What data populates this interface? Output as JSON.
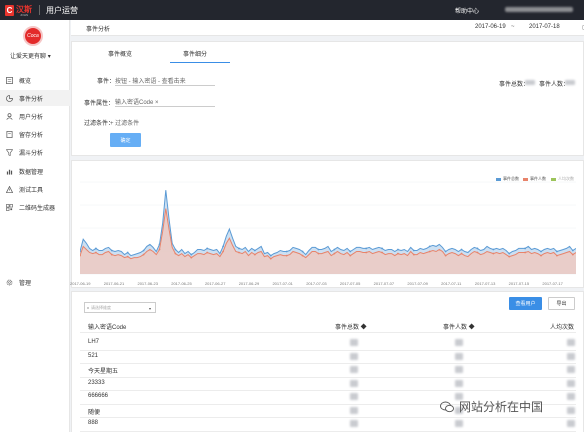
{
  "header": {
    "logo_text": "汉斯",
    "logo_sub": "JOHN",
    "app_title": "用户运营",
    "help": "帮助中心"
  },
  "sidebar": {
    "app_name": "让爱天更有聊",
    "items": [
      {
        "label": "概览",
        "icon": "overview-icon"
      },
      {
        "label": "事件分析",
        "icon": "event-analysis-icon"
      },
      {
        "label": "用户分析",
        "icon": "user-icon"
      },
      {
        "label": "留存分析",
        "icon": "retention-icon"
      },
      {
        "label": "漏斗分析",
        "icon": "funnel-icon"
      },
      {
        "label": "数据管理",
        "icon": "data-manage-icon"
      },
      {
        "label": "测试工具",
        "icon": "test-tool-icon"
      },
      {
        "label": "二维码生成器",
        "icon": "qrcode-icon"
      }
    ],
    "manage": "管理"
  },
  "datebar": {
    "title": "事件分析",
    "start_date": "2017-06-19",
    "end_date": "2017-07-18",
    "separator": "~"
  },
  "filter": {
    "tabs": [
      "事件概览",
      "事件细分"
    ],
    "event_label": "事件：",
    "event_placeholder": "按钮 - 输入密语 - 查看击来",
    "attr_label": "事件属性：",
    "attr_value": "输入密语Code ×",
    "condition_label": "过滤条件：",
    "condition_add": "+ 过滤条件",
    "confirm": "确定",
    "total_events_label": "事件总数：",
    "users_label": "事件人数："
  },
  "chart_data": {
    "type": "area",
    "series": [
      {
        "name": "事件总数",
        "color": "#5b9bd5",
        "values": [
          22,
          34,
          30,
          25,
          23,
          25,
          23,
          23,
          25,
          26,
          23,
          22,
          23,
          22,
          19,
          21,
          18,
          19,
          20,
          21,
          23,
          27,
          29,
          26,
          22,
          29,
          50,
          82,
          54,
          30,
          24,
          21,
          24,
          20,
          22,
          19,
          21,
          24,
          24,
          23,
          25,
          24,
          23,
          24,
          20,
          27,
          37,
          44,
          35,
          27,
          25,
          24,
          26,
          22,
          25,
          23,
          25,
          27,
          20,
          21,
          18,
          20,
          21,
          23,
          22,
          22,
          23,
          26,
          25,
          24,
          22,
          19,
          23,
          26,
          26,
          24,
          24,
          25,
          27,
          22,
          24,
          26,
          24,
          23,
          25,
          22,
          24,
          26,
          26,
          25,
          25,
          26,
          24,
          25,
          26,
          25,
          23,
          24,
          24,
          22,
          24,
          23,
          24,
          22,
          26,
          23,
          23,
          25,
          24,
          25,
          27,
          28,
          27,
          29,
          26,
          22,
          24,
          25,
          24,
          22,
          24,
          22,
          21,
          24,
          26,
          25,
          23,
          24,
          27,
          25,
          24,
          25,
          24,
          25,
          23,
          20,
          22,
          23,
          25,
          25,
          25,
          27,
          24,
          25,
          24,
          22,
          24,
          25,
          24,
          25,
          22,
          23,
          24,
          25,
          27,
          23,
          25
        ]
      },
      {
        "name": "事件人数",
        "color": "#e8836a",
        "values": [
          18,
          27,
          24,
          21,
          20,
          21,
          19,
          19,
          21,
          22,
          19,
          18,
          19,
          18,
          16,
          17,
          15,
          16,
          16,
          17,
          19,
          22,
          24,
          22,
          19,
          24,
          42,
          64,
          44,
          26,
          20,
          18,
          20,
          17,
          19,
          16,
          18,
          20,
          20,
          19,
          21,
          20,
          19,
          20,
          17,
          22,
          30,
          35,
          28,
          22,
          21,
          20,
          22,
          18,
          21,
          19,
          21,
          22,
          17,
          18,
          15,
          17,
          18,
          19,
          18,
          18,
          19,
          22,
          21,
          20,
          18,
          16,
          19,
          22,
          22,
          20,
          20,
          21,
          22,
          18,
          20,
          22,
          20,
          19,
          21,
          18,
          20,
          22,
          22,
          21,
          21,
          22,
          20,
          21,
          22,
          21,
          19,
          20,
          20,
          18,
          20,
          19,
          20,
          18,
          22,
          19,
          19,
          21,
          20,
          21,
          22,
          23,
          22,
          24,
          22,
          18,
          20,
          21,
          20,
          18,
          20,
          18,
          17,
          20,
          22,
          21,
          19,
          20,
          22,
          21,
          20,
          21,
          20,
          21,
          19,
          17,
          18,
          19,
          21,
          21,
          21,
          22,
          20,
          21,
          20,
          18,
          20,
          21,
          20,
          21,
          18,
          19,
          20,
          21,
          22,
          19,
          21
        ]
      },
      {
        "name": "人均次数",
        "color": "#9cc45a",
        "values": []
      }
    ],
    "x_tick_labels": [
      "2017-06-19",
      "2017-06-21",
      "2017-06-23",
      "2017-06-25",
      "2017-06-27",
      "2017-06-29",
      "2017-07-01",
      "2017-07-03",
      "2017-07-05",
      "2017-07-07",
      "2017-07-09",
      "2017-07-11",
      "2017-07-13",
      "2017-07-15",
      "2017-07-17"
    ],
    "legend": "top-right",
    "grid": true
  },
  "table": {
    "select_placeholder": "请选择维度",
    "view_users": "查看用户",
    "export": "导出",
    "columns": [
      "输入密语Code",
      "事件总数 ◆",
      "事件人数 ◆",
      "人均次数"
    ],
    "rows": [
      "LH7",
      "521",
      "今天星期五",
      "23333",
      "666666",
      "随便",
      "888"
    ]
  },
  "watermark": "网站分析在中国"
}
